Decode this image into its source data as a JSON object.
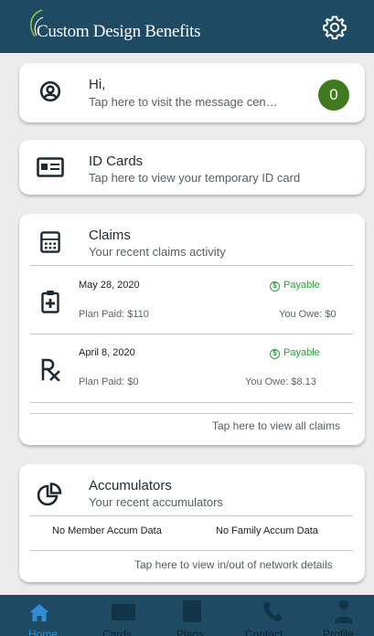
{
  "header": {
    "title": "Custom Design Benefits",
    "settings_icon": "gear-icon"
  },
  "message_card": {
    "greeting": "Hi,",
    "subtitle": "Tap here to visit the message cen…",
    "badge_count": "0",
    "icon": "user-circle-icon"
  },
  "id_card": {
    "title": "ID Cards",
    "subtitle": "Tap here to view your temporary ID card",
    "icon": "id-card-icon"
  },
  "claims": {
    "title": "Claims",
    "subtitle": "Your recent claims activity",
    "icon": "calculator-icon",
    "items": [
      {
        "date": "May 28, 2020",
        "status": "Payable",
        "plan_paid": "Plan Paid: $110",
        "you_owe": "You Owe: $0",
        "icon": "medical-clipboard-icon"
      },
      {
        "date": "April 8, 2020",
        "status": "Payable",
        "plan_paid": "Plan Paid: $0",
        "you_owe": "You Owe: $8.13",
        "icon": "rx-icon"
      }
    ],
    "view_all": "Tap here to view all claims"
  },
  "accumulators": {
    "title": "Accumulators",
    "subtitle": "Your recent accumulators",
    "icon": "pie-chart-icon",
    "member": "No Member Accum Data",
    "family": "No Family Accum Data",
    "details_link": "Tap here to view in/out of network details"
  },
  "tabs": [
    {
      "label": "Home",
      "icon": "home-icon",
      "active": true
    },
    {
      "label": "Cards",
      "icon": "id-card-icon",
      "active": false
    },
    {
      "label": "Plans",
      "icon": "document-icon",
      "active": false
    },
    {
      "label": "Contact",
      "icon": "phone-icon",
      "active": false
    },
    {
      "label": "Profile",
      "icon": "person-icon",
      "active": false
    }
  ],
  "colors": {
    "header": "#1f4a63",
    "badge": "#3f7a1e",
    "status": "#2f9e3e",
    "active_tab": "#2f8fd6"
  }
}
